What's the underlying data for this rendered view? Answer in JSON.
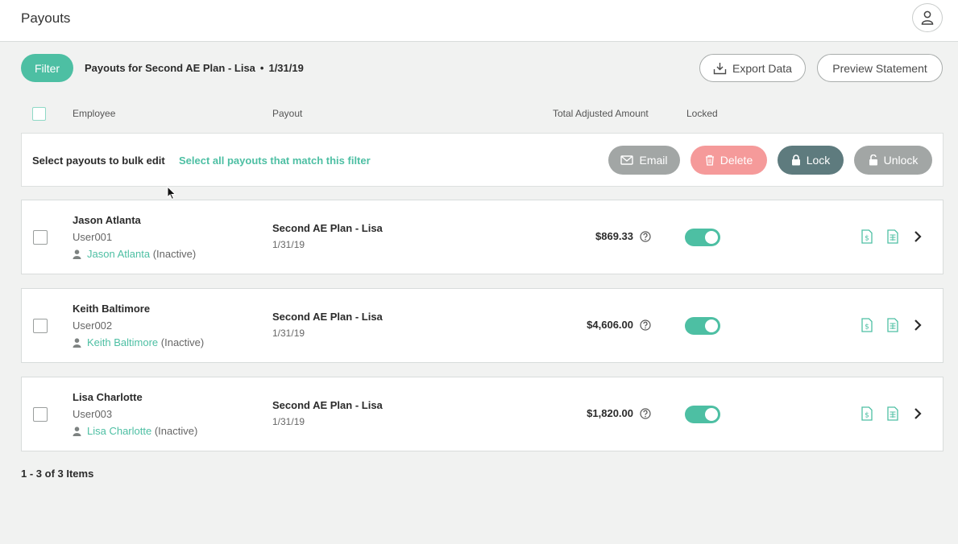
{
  "header": {
    "title": "Payouts"
  },
  "filter": {
    "button_label": "Filter",
    "description": "Payouts for Second AE Plan - Lisa",
    "separator": "•",
    "date": "1/31/19"
  },
  "actions": {
    "export_label": "Export Data",
    "preview_label": "Preview Statement"
  },
  "columns": {
    "employee": "Employee",
    "payout": "Payout",
    "total": "Total Adjusted Amount",
    "locked": "Locked"
  },
  "bulk": {
    "label": "Select payouts to bulk edit",
    "select_all": "Select all payouts that match this filter",
    "email": "Email",
    "delete": "Delete",
    "lock": "Lock",
    "unlock": "Unlock"
  },
  "rows": [
    {
      "name": "Jason Atlanta",
      "user_id": "User001",
      "link_name": "Jason Atlanta",
      "status": "(Inactive)",
      "plan": "Second AE Plan - Lisa",
      "date": "1/31/19",
      "amount": "$869.33",
      "locked": true
    },
    {
      "name": "Keith Baltimore",
      "user_id": "User002",
      "link_name": "Keith Baltimore",
      "status": "(Inactive)",
      "plan": "Second AE Plan - Lisa",
      "date": "1/31/19",
      "amount": "$4,606.00",
      "locked": true
    },
    {
      "name": "Lisa Charlotte",
      "user_id": "User003",
      "link_name": "Lisa Charlotte",
      "status": "(Inactive)",
      "plan": "Second AE Plan - Lisa",
      "date": "1/31/19",
      "amount": "$1,820.00",
      "locked": true
    }
  ],
  "pagination": {
    "summary": "1 - 3 of 3 Items"
  },
  "colors": {
    "accent": "#4dbfa3",
    "delete": "#f59a9a",
    "lock": "#5e7b7e",
    "disabled": "#a2a6a5"
  }
}
